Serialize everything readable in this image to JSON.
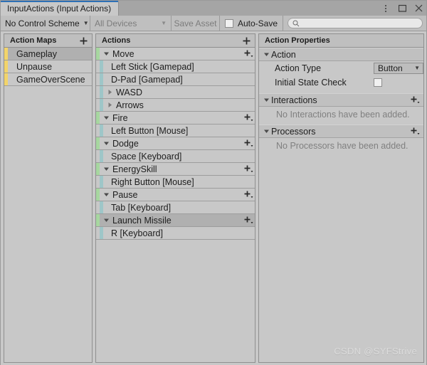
{
  "window": {
    "tab_title": "InputActions (Input Actions)",
    "controls": [
      {
        "name": "kebab-menu-icon",
        "glyph": "⋮"
      },
      {
        "name": "maximize-icon",
        "glyph": "□"
      },
      {
        "name": "close-icon",
        "glyph": "✕"
      }
    ]
  },
  "toolbar": {
    "control_scheme": "No Control Scheme",
    "devices": "All Devices",
    "save_asset": "Save Asset",
    "autosave_label": "Auto-Save",
    "autosave_checked": false,
    "search_value": "",
    "search_placeholder": ""
  },
  "action_maps": {
    "header": "Action Maps",
    "add_label": "+",
    "items": [
      {
        "label": "Gameplay",
        "selected": true
      },
      {
        "label": "Unpause",
        "selected": false
      },
      {
        "label": "GameOverScene",
        "selected": false
      }
    ]
  },
  "actions": {
    "header": "Actions",
    "add_label": "+",
    "items": [
      {
        "kind": "action",
        "label": "Move",
        "expanded": true,
        "selected": false
      },
      {
        "kind": "binding",
        "label": "Left Stick [Gamepad]",
        "selected": false
      },
      {
        "kind": "binding",
        "label": "D-Pad [Gamepad]",
        "selected": false
      },
      {
        "kind": "composite",
        "label": "WASD",
        "expanded": false,
        "selected": false
      },
      {
        "kind": "composite",
        "label": "Arrows",
        "expanded": false,
        "selected": false
      },
      {
        "kind": "action",
        "label": "Fire",
        "expanded": true,
        "selected": false
      },
      {
        "kind": "binding",
        "label": "Left Button [Mouse]",
        "selected": false
      },
      {
        "kind": "action",
        "label": "Dodge",
        "expanded": true,
        "selected": false
      },
      {
        "kind": "binding",
        "label": "Space [Keyboard]",
        "selected": false
      },
      {
        "kind": "action",
        "label": "EnergySkill",
        "expanded": true,
        "selected": false
      },
      {
        "kind": "binding",
        "label": "Right Button [Mouse]",
        "selected": false
      },
      {
        "kind": "action",
        "label": "Pause",
        "expanded": true,
        "selected": false
      },
      {
        "kind": "binding",
        "label": "Tab [Keyboard]",
        "selected": false
      },
      {
        "kind": "action",
        "label": "Launch Missile",
        "expanded": true,
        "selected": true
      },
      {
        "kind": "binding",
        "label": "R [Keyboard]",
        "selected": false
      }
    ]
  },
  "properties": {
    "header": "Action Properties",
    "action_section": {
      "title": "Action",
      "expanded": true,
      "action_type_label": "Action Type",
      "action_type_value": "Button",
      "initial_state_check_label": "Initial State Check",
      "initial_state_check_checked": false
    },
    "interactions_section": {
      "title": "Interactions",
      "expanded": true,
      "empty_text": "No Interactions have been added."
    },
    "processors_section": {
      "title": "Processors",
      "expanded": true,
      "empty_text": "No Processors have been added."
    }
  },
  "watermark": "CSDN @SYFStrive",
  "colors": {
    "accent_blue": "#2c6fb5",
    "map_stripe": "#f2d46a",
    "action_stripe": "#a7d7a0",
    "binding_stripe": "#9ec6c8",
    "selection": "#b0b0b0",
    "window_bg": "#c8c8c8"
  }
}
